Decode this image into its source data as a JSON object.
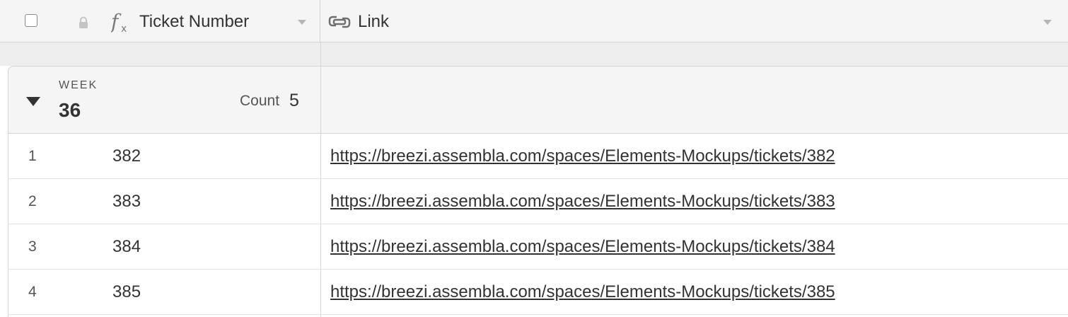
{
  "header": {
    "ticket_column": {
      "label": "Ticket Number",
      "type_icon": "formula-fx-icon",
      "locked_icon": "lock-icon"
    },
    "link_column": {
      "label": "Link",
      "type_icon": "url-link-icon"
    }
  },
  "group": {
    "field_label": "WEEK",
    "value": "36",
    "count_label": "Count",
    "count_value": "5",
    "expanded": true
  },
  "rows": [
    {
      "num": "1",
      "ticket": "382",
      "link": "https://breezi.assembla.com/spaces/Elements-Mockups/tickets/382"
    },
    {
      "num": "2",
      "ticket": "383",
      "link": "https://breezi.assembla.com/spaces/Elements-Mockups/tickets/383"
    },
    {
      "num": "3",
      "ticket": "384",
      "link": "https://breezi.assembla.com/spaces/Elements-Mockups/tickets/384"
    },
    {
      "num": "4",
      "ticket": "385",
      "link": "https://breezi.assembla.com/spaces/Elements-Mockups/tickets/385"
    }
  ],
  "colors": {
    "header_bg": "#f5f5f5",
    "border": "#d4d4d4",
    "text": "#333333",
    "muted": "#555555"
  }
}
